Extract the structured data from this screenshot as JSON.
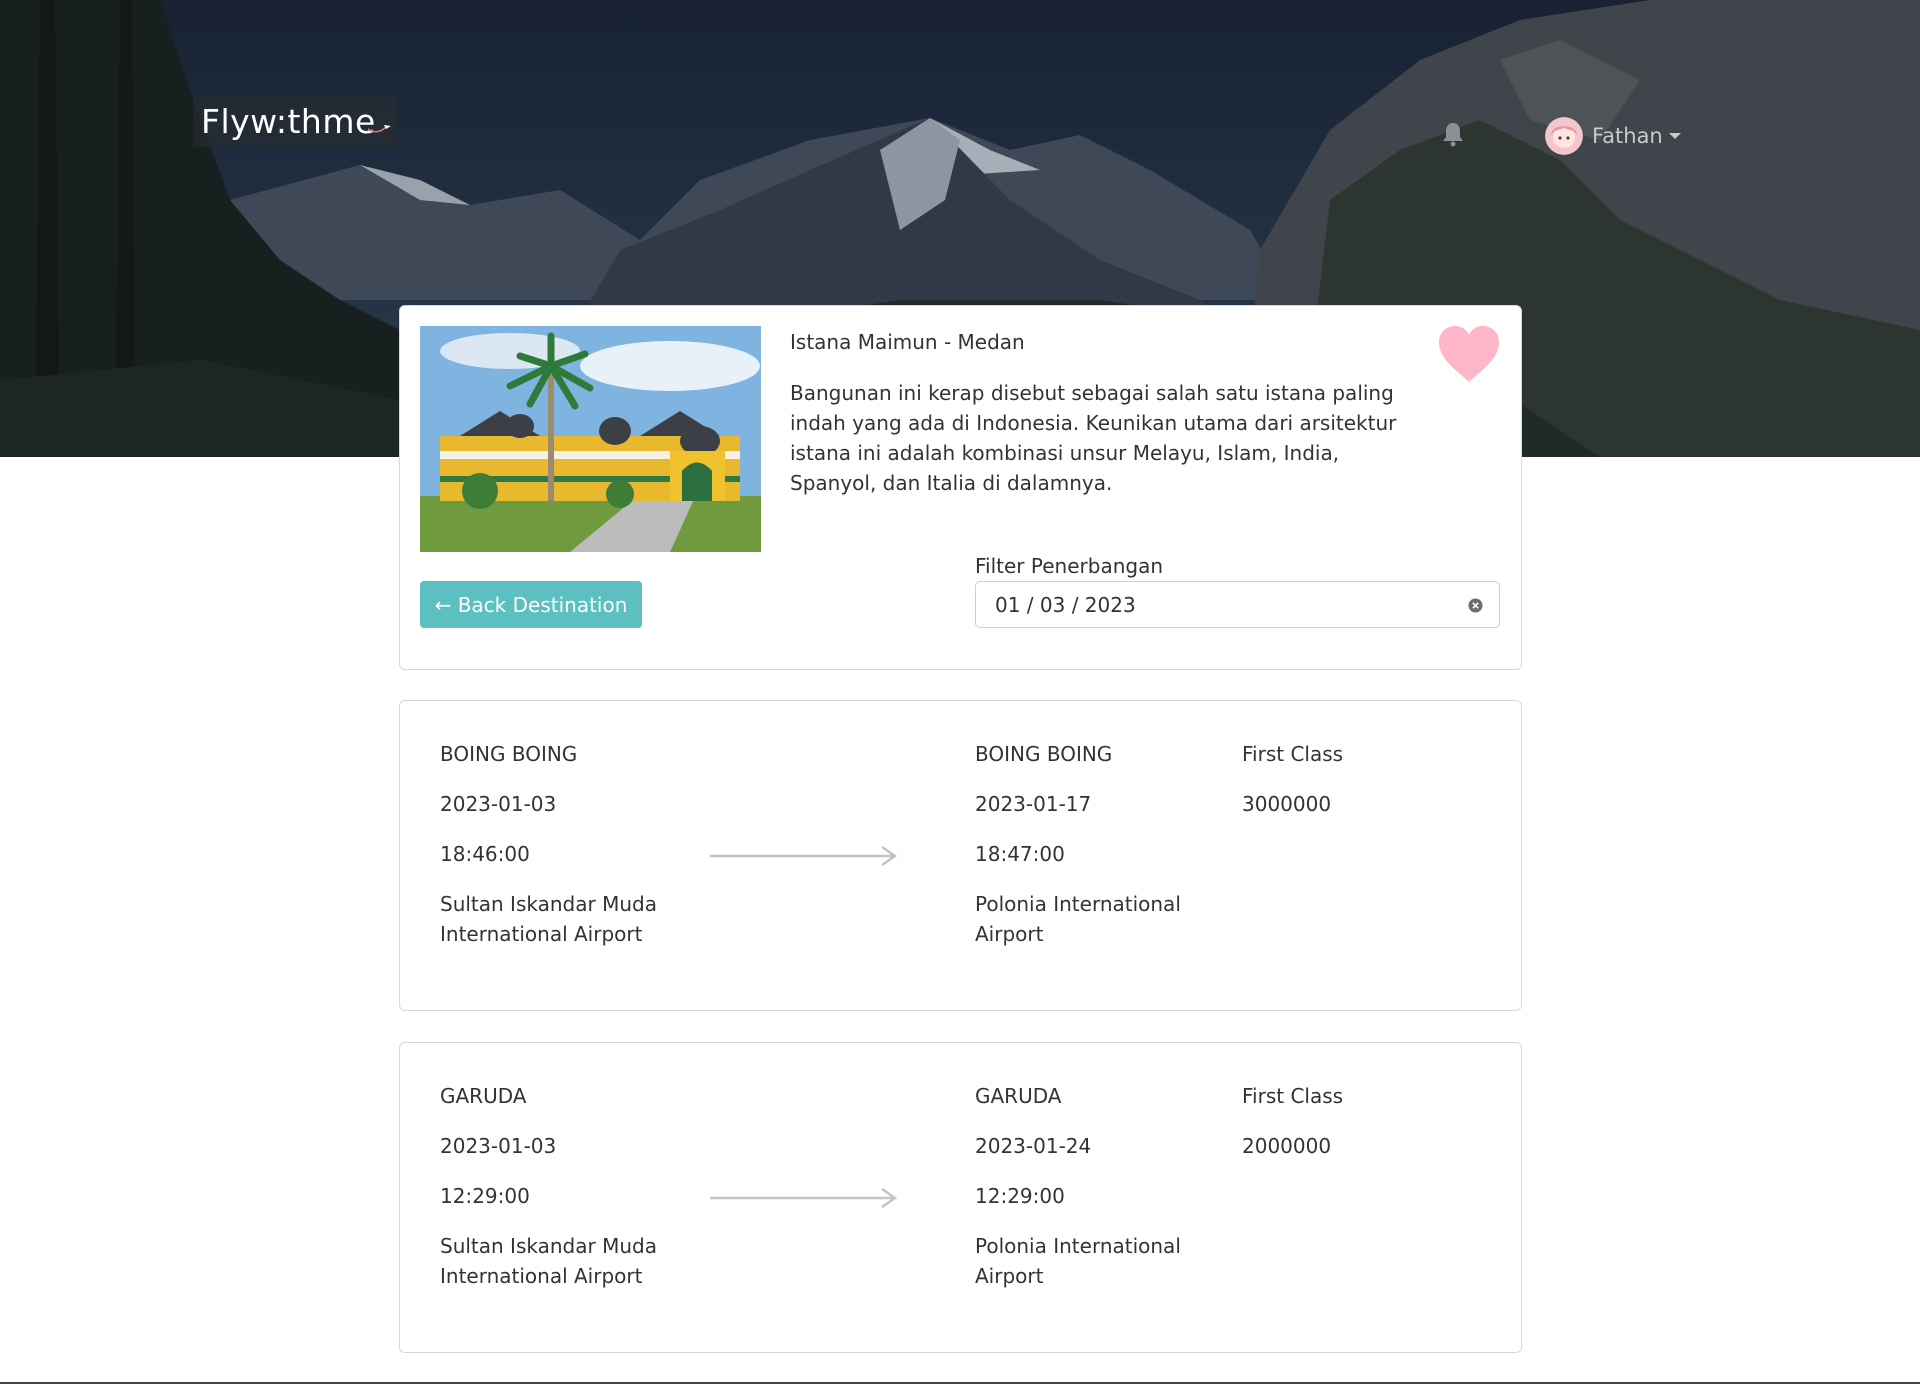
{
  "brand": {
    "logo_text": "Flyw:thme"
  },
  "header": {
    "user_name": "Fathan"
  },
  "destination": {
    "title": "Istana Maimun - Medan",
    "description": "Bangunan ini kerap disebut sebagai salah satu istana paling indah yang ada di Indonesia. Keunikan utama dari arsitektur istana ini adalah kombinasi unsur Melayu, Islam, India, Spanyol, dan Italia di dalamnya.",
    "favorite_color": "#ffb6c8"
  },
  "actions": {
    "back_label": "← Back Destination"
  },
  "filter": {
    "label": "Filter Penerbangan",
    "value": "01 / 03 / 2023"
  },
  "flights": [
    {
      "origin": {
        "airline": "BOING BOING",
        "date": "2023-01-03",
        "time": "18:46:00",
        "airport": "Sultan Iskandar Muda International Airport"
      },
      "destination": {
        "airline": "BOING BOING",
        "date": "2023-01-17",
        "time": "18:47:00",
        "airport": "Polonia International Airport"
      },
      "class": "First Class",
      "price": "3000000"
    },
    {
      "origin": {
        "airline": "GARUDA",
        "date": "2023-01-03",
        "time": "12:29:00",
        "airport": "Sultan Iskandar Muda International Airport"
      },
      "destination": {
        "airline": "GARUDA",
        "date": "2023-01-24",
        "time": "12:29:00",
        "airport": "Polonia International Airport"
      },
      "class": "First Class",
      "price": "2000000"
    }
  ],
  "colors": {
    "accent": "#5bc0bf",
    "hero_sky": "#1c2a3e"
  }
}
